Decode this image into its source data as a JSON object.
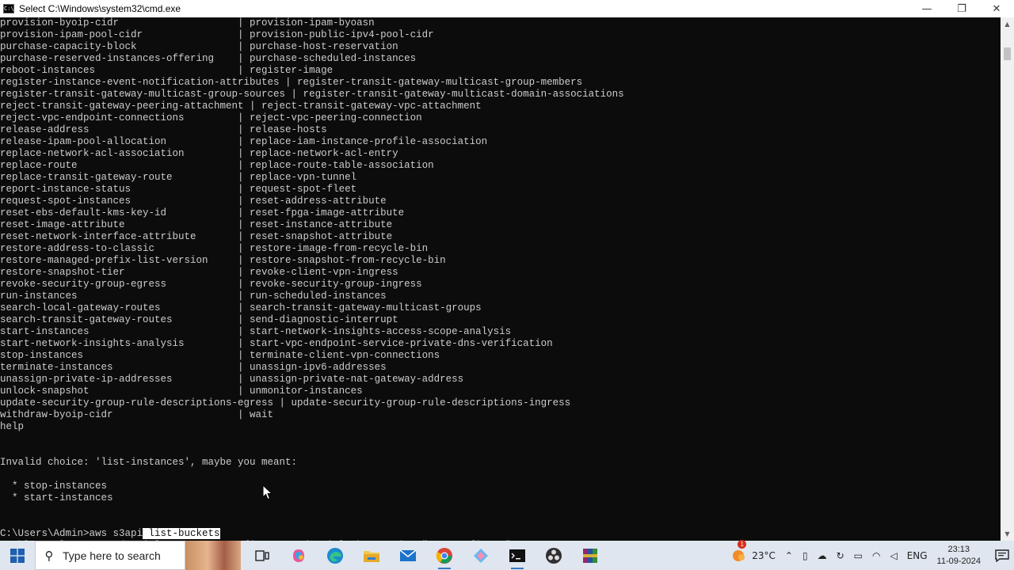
{
  "window": {
    "title": "Select C:\\Windows\\system32\\cmd.exe",
    "app_icon": "cmd-icon",
    "controls": {
      "minimize": "—",
      "restore": "❐",
      "close": "✕"
    }
  },
  "console": {
    "lines": [
      "provision-byoip-cidr                    | provision-ipam-byoasn",
      "provision-ipam-pool-cidr                | provision-public-ipv4-pool-cidr",
      "purchase-capacity-block                 | purchase-host-reservation",
      "purchase-reserved-instances-offering    | purchase-scheduled-instances",
      "reboot-instances                        | register-image",
      "register-instance-event-notification-attributes | register-transit-gateway-multicast-group-members",
      "register-transit-gateway-multicast-group-sources | register-transit-gateway-multicast-domain-associations",
      "reject-transit-gateway-peering-attachment | reject-transit-gateway-vpc-attachment",
      "reject-vpc-endpoint-connections         | reject-vpc-peering-connection",
      "release-address                         | release-hosts",
      "release-ipam-pool-allocation            | replace-iam-instance-profile-association",
      "replace-network-acl-association         | replace-network-acl-entry",
      "replace-route                           | replace-route-table-association",
      "replace-transit-gateway-route           | replace-vpn-tunnel",
      "report-instance-status                  | request-spot-fleet",
      "request-spot-instances                  | reset-address-attribute",
      "reset-ebs-default-kms-key-id            | reset-fpga-image-attribute",
      "reset-image-attribute                   | reset-instance-attribute",
      "reset-network-interface-attribute       | reset-snapshot-attribute",
      "restore-address-to-classic              | restore-image-from-recycle-bin",
      "restore-managed-prefix-list-version     | restore-snapshot-from-recycle-bin",
      "restore-snapshot-tier                   | revoke-client-vpn-ingress",
      "revoke-security-group-egress            | revoke-security-group-ingress",
      "run-instances                           | run-scheduled-instances",
      "search-local-gateway-routes             | search-transit-gateway-multicast-groups",
      "search-transit-gateway-routes           | send-diagnostic-interrupt",
      "start-instances                         | start-network-insights-access-scope-analysis",
      "start-network-insights-analysis         | start-vpc-endpoint-service-private-dns-verification",
      "stop-instances                          | terminate-client-vpn-connections",
      "terminate-instances                     | unassign-ipv6-addresses",
      "unassign-private-ip-addresses           | unassign-private-nat-gateway-address",
      "unlock-snapshot                         | unmonitor-instances",
      "update-security-group-rule-descriptions-egress | update-security-group-rule-descriptions-ingress",
      "withdraw-byoip-cidr                     | wait",
      "help",
      "",
      "",
      "Invalid choice: 'list-instances', maybe you meant:",
      "",
      "  * stop-instances",
      "  * start-instances",
      "",
      ""
    ],
    "prompt": "C:\\Users\\Admin>aws s3api",
    "selected_text": " list-buckets",
    "last_line": "Unable to locate credentials. You can configure credentials by running \"aws configure\"."
  },
  "scrollbar": {
    "up": "▲",
    "down": "▼"
  },
  "taskbar": {
    "search_placeholder": "Type here to search",
    "search_icon": "search-icon",
    "apps": [
      "task-view-icon",
      "copilot-icon",
      "edge-icon",
      "file-explorer-icon",
      "mail-icon",
      "chrome-icon",
      "app-icon",
      "cmd-icon",
      "obs-icon",
      "winrar-icon"
    ],
    "weather": {
      "temp": "23°C",
      "badge": "1"
    },
    "language": "ENG",
    "time": "23:13",
    "date": "11-09-2024"
  }
}
